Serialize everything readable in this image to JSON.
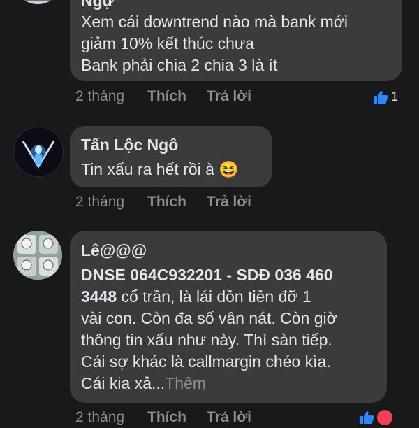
{
  "comments": [
    {
      "author": "Ngự",
      "lines": [
        "Xem cái downtrend nào mà bank mới",
        "giảm 10% kết thúc chưa",
        "Bank phải chia 2 chia 3 là ít"
      ],
      "time": "2 tháng",
      "like_label": "Thích",
      "reply_label": "Trả lời",
      "reaction_count": "1"
    },
    {
      "author": "Tấn Lộc Ngô",
      "text": "Tin xấu ra hết rồi à",
      "emoji": "😆",
      "time": "2 tháng",
      "like_label": "Thích",
      "reply_label": "Trả lời"
    },
    {
      "author": "Lê@@@",
      "bold_line1": "DNSE 064C932201 - SDĐ 036 460",
      "bold_line2_start": "3448",
      "line2_rest": " cổ trần, là lái dồn tiền đỡ 1",
      "lines": [
        "vài con. Còn đa số vân nát. Còn giờ",
        "thông tin xấu như này. Thì sàn tiếp.",
        "Cái sợ khác là callmargin chéo kìa."
      ],
      "last_line": "Cái kia xả...",
      "see_more": "Thêm",
      "time": "2 tháng",
      "like_label": "Thích",
      "reply_label": "Trả lời"
    }
  ],
  "colors": {
    "background": "#18191a",
    "bubble": "#3a3b3c",
    "text": "#e4e6eb",
    "muted": "#8a8d91",
    "like_blue": "#2d88ff"
  }
}
